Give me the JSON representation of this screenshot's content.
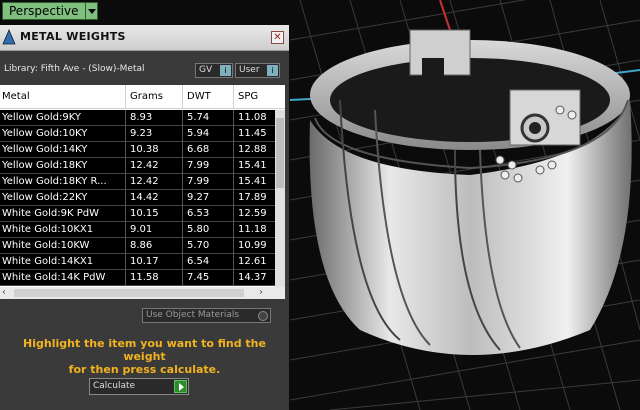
{
  "viewport": {
    "mode_label": "Perspective"
  },
  "panel": {
    "title": "METAL WEIGHTS",
    "library_label": "Library: Fifth Ave - (Slow)-Metal",
    "toggle_gv": "GV",
    "toggle_user": "User",
    "columns": [
      "Metal",
      "Grams",
      "DWT",
      "SPG"
    ],
    "rows": [
      {
        "metal": "Yellow Gold:9KY",
        "grams": "8.93",
        "dwt": "5.74",
        "spg": "11.08"
      },
      {
        "metal": "Yellow Gold:10KY",
        "grams": "9.23",
        "dwt": "5.94",
        "spg": "11.45"
      },
      {
        "metal": "Yellow Gold:14KY",
        "grams": "10.38",
        "dwt": "6.68",
        "spg": "12.88"
      },
      {
        "metal": "Yellow Gold:18KY",
        "grams": "12.42",
        "dwt": "7.99",
        "spg": "15.41"
      },
      {
        "metal": "Yellow Gold:18KY R...",
        "grams": "12.42",
        "dwt": "7.99",
        "spg": "15.41"
      },
      {
        "metal": "Yellow Gold:22KY",
        "grams": "14.42",
        "dwt": "9.27",
        "spg": "17.89"
      },
      {
        "metal": "White Gold:9K PdW",
        "grams": "10.15",
        "dwt": "6.53",
        "spg": "12.59"
      },
      {
        "metal": "White Gold:10KX1",
        "grams": "9.01",
        "dwt": "5.80",
        "spg": "11.18"
      },
      {
        "metal": "White Gold:10KW",
        "grams": "8.86",
        "dwt": "5.70",
        "spg": "10.99"
      },
      {
        "metal": "White Gold:14KX1",
        "grams": "10.17",
        "dwt": "6.54",
        "spg": "12.61"
      },
      {
        "metal": "White Gold:14K PdW",
        "grams": "11.58",
        "dwt": "7.45",
        "spg": "14.37"
      }
    ],
    "use_object_materials_label": "Use Object Materials",
    "hint_line1": "Highlight the item you want to find the weight",
    "hint_line2": "for then press calculate.",
    "calculate_label": "Calculate"
  },
  "colors": {
    "hint": "#f2b320",
    "accent_green": "#7fbf7f",
    "grid_line": "#3a3a3a",
    "axis_red": "#c83232",
    "axis_cyan": "#3fa6c8"
  }
}
